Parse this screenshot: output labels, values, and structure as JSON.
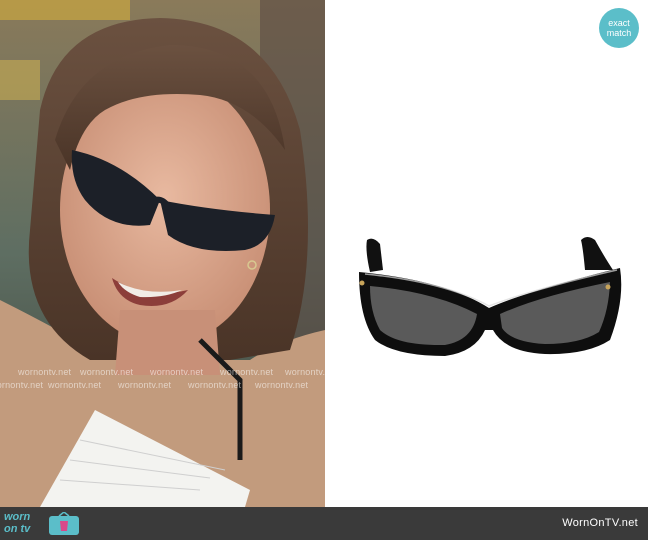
{
  "badge": {
    "line1": "exact",
    "line2": "match"
  },
  "watermark": {
    "text": "wornontv.net"
  },
  "footer": {
    "logo_top": "worn",
    "logo_bottom": "on tv",
    "site": "WornOnTV.net"
  },
  "colors": {
    "accent": "#5bbec9",
    "footer_bg": "#3a3a3a"
  }
}
